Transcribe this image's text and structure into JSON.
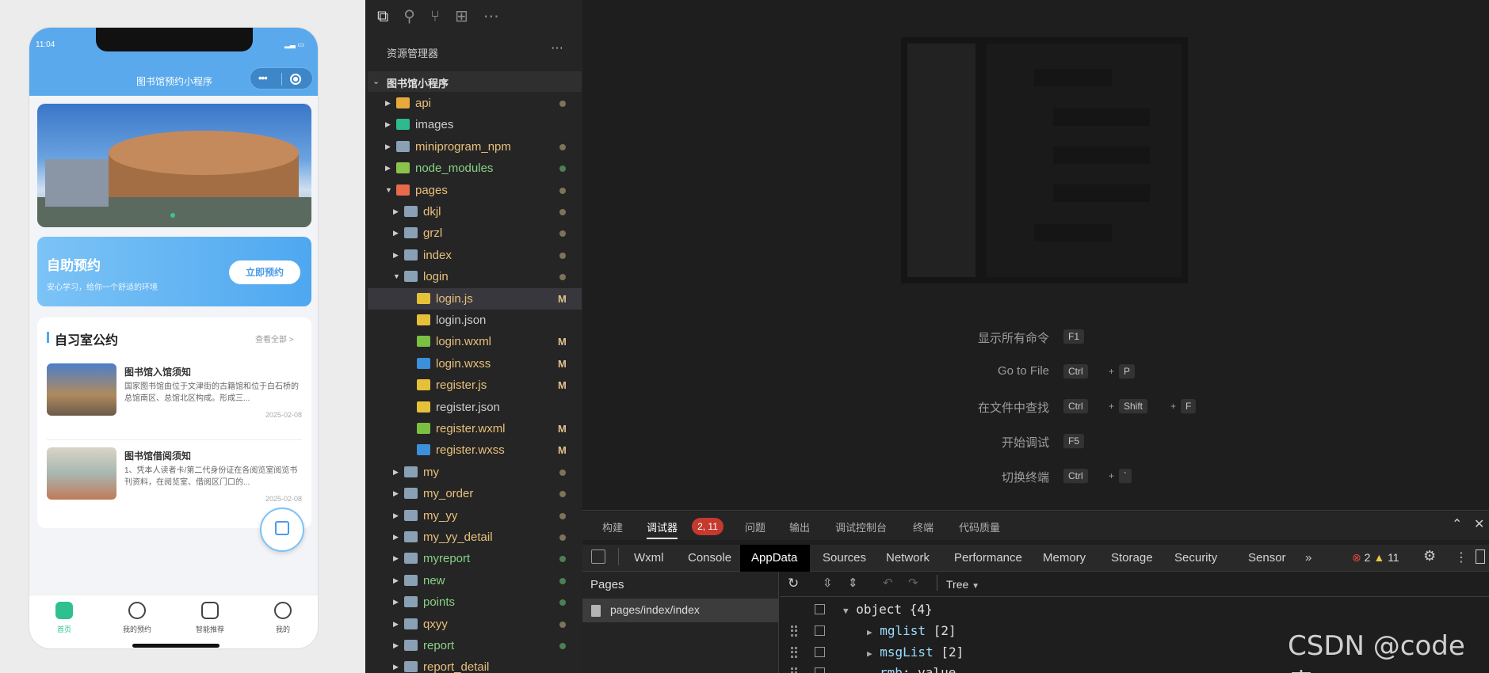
{
  "simulator": {
    "time": "11:04",
    "title": "图书馆预约小程序",
    "booking": {
      "title": "自助预约",
      "subtitle": "安心学习，给你一个舒适的环境",
      "button": "立即预约"
    },
    "notice": {
      "title": "自习室公约",
      "more": "查看全部 >",
      "items": [
        {
          "title": "图书馆入馆须知",
          "text": "国家图书馆由位于文津街的古籍馆和位于白石桥的总馆南区、总馆北区构成。形成三...",
          "date": "2025-02-08"
        },
        {
          "title": "图书馆借阅须知",
          "text": "1、凭本人读者卡/第二代身份证在各阅览室阅览书刊资料，在阅览室、借阅区门口的...",
          "date": "2025-02-08"
        }
      ]
    },
    "tabs": [
      {
        "label": "首页",
        "active": true
      },
      {
        "label": "我的预约",
        "active": false
      },
      {
        "label": "智能推荐",
        "active": false
      },
      {
        "label": "我的",
        "active": false
      }
    ]
  },
  "explorer": {
    "header": "资源管理器",
    "more": "···",
    "project": "图书馆小程序",
    "items": [
      {
        "name": "api",
        "color": "#e8c07a",
        "icon": "#e8a93c",
        "status": "dot"
      },
      {
        "name": "images",
        "color": "#cccccc",
        "icon": "#2fb98e",
        "status": ""
      },
      {
        "name": "miniprogram_npm",
        "color": "#e8c07a",
        "icon": "#8aa0b4",
        "status": "dot"
      },
      {
        "name": "node_modules",
        "color": "#89d185",
        "icon": "#8bc34a",
        "status": "green"
      },
      {
        "name": "pages",
        "color": "#e8c07a",
        "icon": "#e86a4a",
        "status": "dot"
      },
      {
        "name": "dkjl",
        "color": "#e8c07a",
        "icon": "#8aa0b4",
        "status": "dot"
      },
      {
        "name": "grzl",
        "color": "#e8c07a",
        "icon": "#8aa0b4",
        "status": "dot"
      },
      {
        "name": "index",
        "color": "#e8c07a",
        "icon": "#8aa0b4",
        "status": "dot"
      },
      {
        "name": "login",
        "color": "#e8c07a",
        "icon": "#8aa0b4",
        "status": "dot"
      },
      {
        "name": "login.js",
        "color": "#e8c07a",
        "icon": "#e5c13a",
        "status": "M"
      },
      {
        "name": "login.json",
        "color": "#cccccc",
        "icon": "#e5c13a",
        "status": ""
      },
      {
        "name": "login.wxml",
        "color": "#e8c07a",
        "icon": "#7bc043",
        "status": "M"
      },
      {
        "name": "login.wxss",
        "color": "#e8c07a",
        "icon": "#3c8fd9",
        "status": "M"
      },
      {
        "name": "register.js",
        "color": "#e8c07a",
        "icon": "#e5c13a",
        "status": "M"
      },
      {
        "name": "register.json",
        "color": "#cccccc",
        "icon": "#e5c13a",
        "status": ""
      },
      {
        "name": "register.wxml",
        "color": "#e8c07a",
        "icon": "#7bc043",
        "status": "M"
      },
      {
        "name": "register.wxss",
        "color": "#e8c07a",
        "icon": "#3c8fd9",
        "status": "M"
      },
      {
        "name": "my",
        "color": "#e8c07a",
        "icon": "#8aa0b4",
        "status": "dot"
      },
      {
        "name": "my_order",
        "color": "#e8c07a",
        "icon": "#8aa0b4",
        "status": "dot"
      },
      {
        "name": "my_yy",
        "color": "#e8c07a",
        "icon": "#8aa0b4",
        "status": "dot"
      },
      {
        "name": "my_yy_detail",
        "color": "#e8c07a",
        "icon": "#8aa0b4",
        "status": "dot"
      },
      {
        "name": "myreport",
        "color": "#89d185",
        "icon": "#8aa0b4",
        "status": "green"
      },
      {
        "name": "new",
        "color": "#89d185",
        "icon": "#8aa0b4",
        "status": "green"
      },
      {
        "name": "points",
        "color": "#89d185",
        "icon": "#8aa0b4",
        "status": "green"
      },
      {
        "name": "qxyy",
        "color": "#e8c07a",
        "icon": "#8aa0b4",
        "status": "dot"
      },
      {
        "name": "report",
        "color": "#89d185",
        "icon": "#8aa0b4",
        "status": "green"
      },
      {
        "name": "report_detail",
        "color": "#e8c07a",
        "icon": "#8aa0b4",
        "status": ""
      }
    ]
  },
  "welcome": {
    "commands": [
      {
        "label": "显示所有命令",
        "keys": [
          "F1"
        ]
      },
      {
        "label": "Go to File",
        "keys": [
          "Ctrl",
          "P"
        ]
      },
      {
        "label": "在文件中查找",
        "keys": [
          "Ctrl",
          "Shift",
          "F"
        ]
      },
      {
        "label": "开始调试",
        "keys": [
          "F5"
        ]
      },
      {
        "label": "切换终端",
        "keys": [
          "Ctrl",
          "`"
        ]
      }
    ]
  },
  "panel": {
    "tabs": [
      "构建",
      "调试器",
      "问题",
      "输出",
      "调试控制台",
      "终端",
      "代码质量"
    ],
    "debugger_badge": "2, 11",
    "devtools_tabs": [
      "Wxml",
      "Console",
      "AppData",
      "Sources",
      "Network",
      "Performance",
      "Memory",
      "Storage",
      "Security",
      "Sensor"
    ],
    "more_tabs": "»",
    "errors": "2",
    "warnings": "11",
    "pages_header": "Pages",
    "page_item": "pages/index/index",
    "view_mode": "Tree",
    "tree": [
      {
        "key": "object",
        "value": "{4}"
      },
      {
        "key": "mglist",
        "value": "[2]"
      },
      {
        "key": "msgList",
        "value": "[2]"
      },
      {
        "key": "rmb",
        "value": ": value"
      }
    ]
  },
  "watermark": "CSDN @code袁"
}
